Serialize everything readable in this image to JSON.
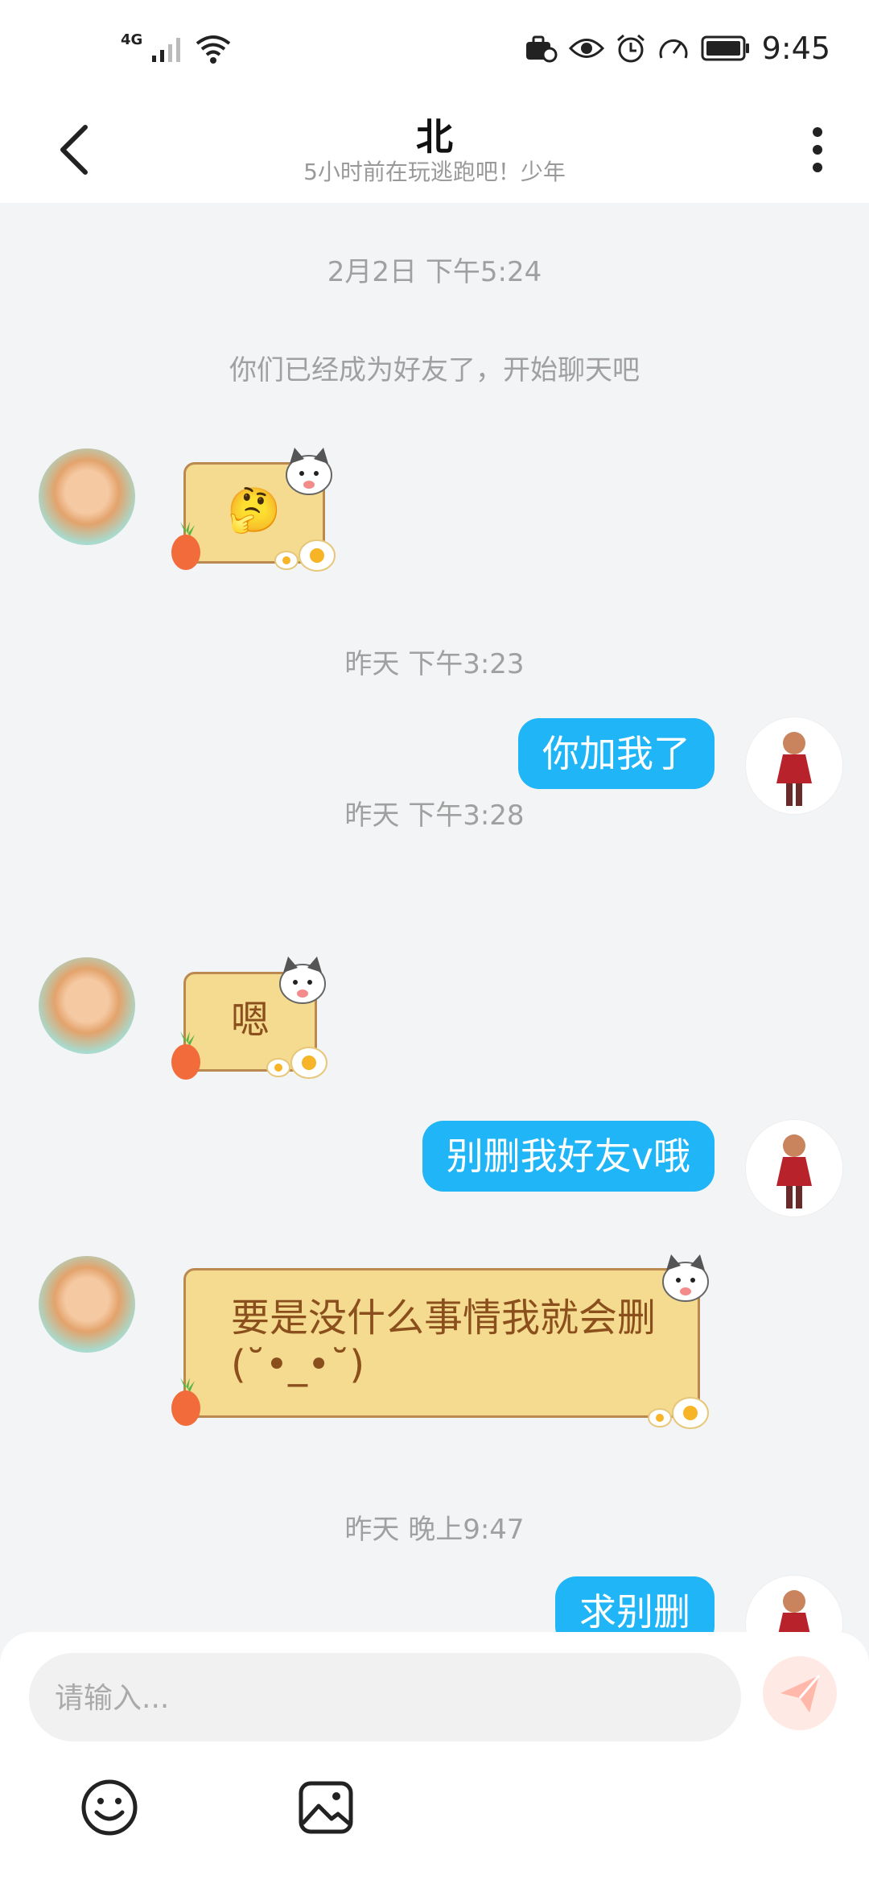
{
  "status_bar": {
    "network": "4G",
    "time": "9:45"
  },
  "header": {
    "name": "北",
    "subtitle": "5小时前在玩逃跑吧！少年"
  },
  "messages": {
    "ts1": "2月2日 下午5:24",
    "system": "你们已经成为好友了，开始聊天吧",
    "m1": "🤔",
    "ts2": "昨天 下午3:23",
    "m2": "你加我了",
    "ts3": "昨天 下午3:28",
    "m3": "嗯",
    "m4": "别删我好友v哦",
    "m5_line1": "要是没什么事情我就会删",
    "m5_line2": "(˘•_•˘)",
    "ts4": "昨天 晚上9:47",
    "m6": "求别删"
  },
  "composer": {
    "placeholder": "请输入..."
  },
  "icons": {
    "emoji": "emoji-icon",
    "image": "image-icon",
    "send": "send-icon"
  },
  "colors": {
    "my_bubble": "#1fb5f7",
    "card_fill": "#f4db8f",
    "card_text": "#8a4f1c"
  }
}
